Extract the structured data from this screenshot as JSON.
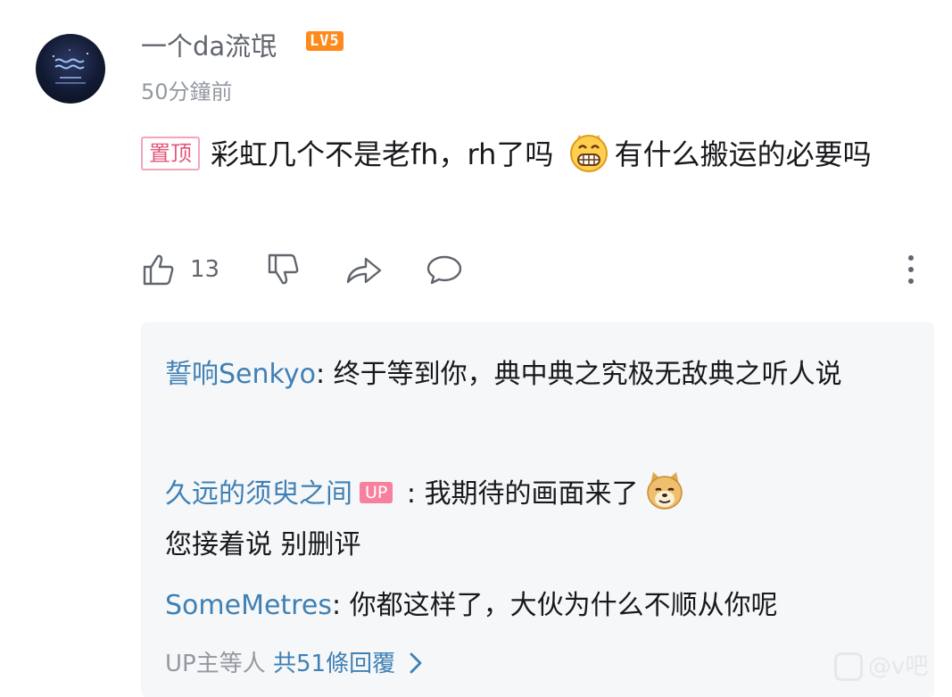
{
  "comment": {
    "author": "一个da流氓",
    "level_badge": "LV5",
    "time": "50分鐘前",
    "pin_label": "置顶",
    "text_before_emoji": "彩虹几个不是老fh，rh了吗",
    "text_after_emoji": "有什么搬运的必要吗",
    "like_count": "13",
    "icons": [
      "like-icon",
      "dislike-icon",
      "share-icon",
      "reply-icon",
      "more-icon",
      "grin-emoji",
      "doge-emoji"
    ]
  },
  "replies": [
    {
      "name": "誓响Senkyo",
      "sep": ": ",
      "text": "终于等到你，典中典之究极无敌典之听人说"
    },
    {
      "name": "久远的须臾之间",
      "up_tag": "UP",
      "sep": " : ",
      "text_line1": "我期待的画面来了",
      "text_line2": "您接着说 别删评"
    },
    {
      "name": "SomeMetres",
      "sep": ": ",
      "text": "你都这样了，大伙为什么不顺从你呢"
    }
  ],
  "more_replies": {
    "prefix": "UP主等人",
    "link": "共51條回覆"
  },
  "watermark": "@v吧",
  "colors": {
    "link_blue": "#3f80b5",
    "pin_pink": "#e4587a",
    "up_pink": "#f7809f",
    "level_orange": "#ff8a1c",
    "gray_text": "#9499a0"
  }
}
